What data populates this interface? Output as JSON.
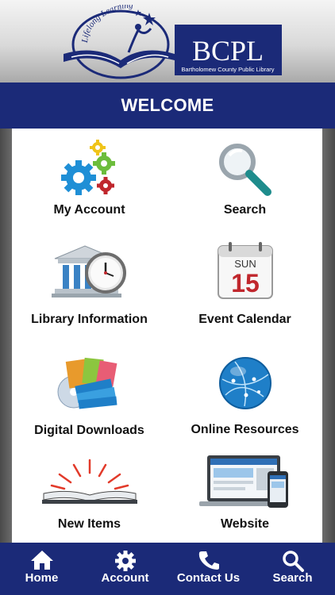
{
  "header": {
    "logo_arc_text": "Lifelong Learning",
    "logo_abbrev": "BCPL",
    "logo_full_name": "Bartholomew County Public Library"
  },
  "welcome": "WELCOME",
  "tiles": [
    {
      "label": "My Account",
      "icon": "gears-icon"
    },
    {
      "label": "Search",
      "icon": "magnifier-icon"
    },
    {
      "label": "Library Information",
      "icon": "library-building-clock-icon"
    },
    {
      "label": "Event Calendar",
      "icon": "calendar-icon"
    },
    {
      "label": "Digital Downloads",
      "icon": "books-disc-icon"
    },
    {
      "label": "Online Resources",
      "icon": "globe-icon"
    },
    {
      "label": "New Items",
      "icon": "open-book-icon"
    },
    {
      "label": "Website",
      "icon": "devices-icon"
    }
  ],
  "calendar": {
    "day": "SUN",
    "date": "15"
  },
  "tabs": [
    {
      "label": "Home",
      "icon": "home-icon"
    },
    {
      "label": "Account",
      "icon": "gear-icon"
    },
    {
      "label": "Contact Us",
      "icon": "phone-icon"
    },
    {
      "label": "Search",
      "icon": "search-icon"
    }
  ],
  "colors": {
    "brand_navy": "#1b2a78",
    "calendar_red": "#c0272d",
    "globe_blue": "#1f7fc8"
  }
}
